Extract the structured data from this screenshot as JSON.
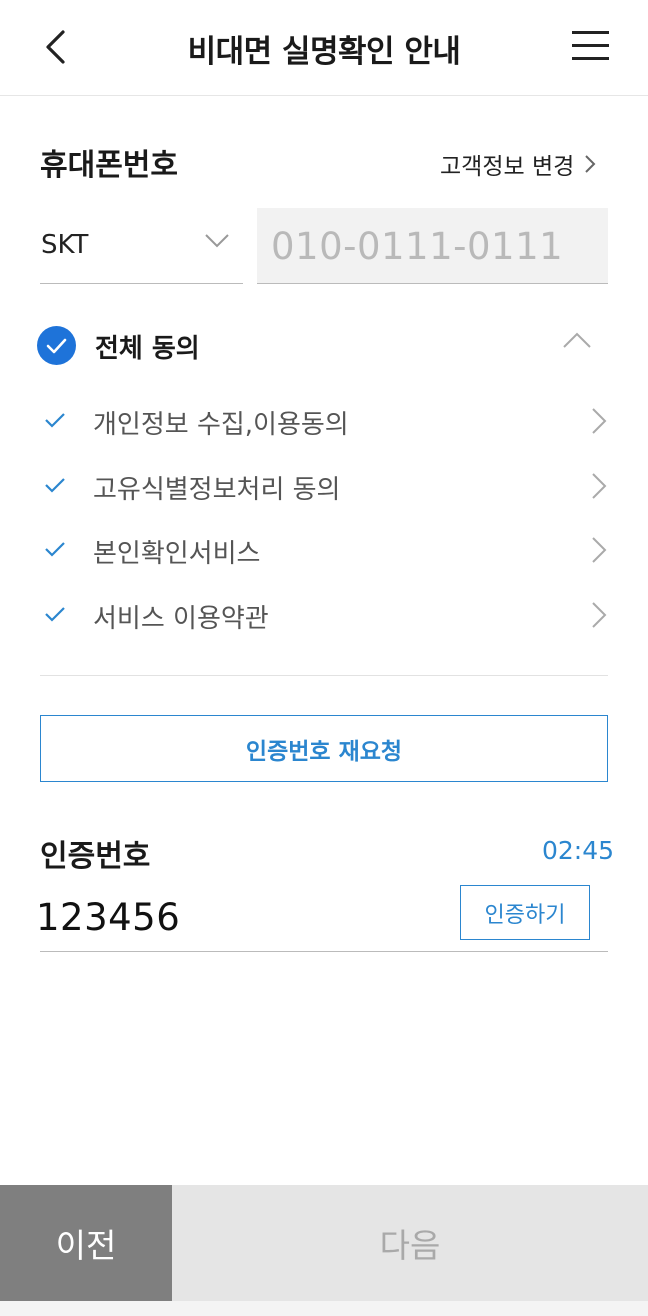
{
  "header": {
    "title": "비대면 실명확인 안내",
    "back_icon": "chevron-left-icon",
    "menu_icon": "hamburger-menu-icon"
  },
  "phone": {
    "label": "휴대폰번호",
    "change_link": "고객정보 변경",
    "carrier": "SKT",
    "number_placeholder": "010-0111-0111"
  },
  "agreements": {
    "all_label": "전체 동의",
    "all_checked": true,
    "items": [
      {
        "label": "개인정보 수집,이용동의",
        "checked": true
      },
      {
        "label": "고유식별정보처리 동의",
        "checked": true
      },
      {
        "label": "본인확인서비스",
        "checked": true
      },
      {
        "label": "서비스 이용약관",
        "checked": true
      }
    ]
  },
  "resend_button": "인증번호 재요청",
  "auth": {
    "label": "인증번호",
    "timer": "02:45",
    "code_value": "123456",
    "verify_button": "인증하기"
  },
  "footer": {
    "prev_label": "이전",
    "next_label": "다음"
  },
  "colors": {
    "accent": "#2b86cf",
    "check_fill": "#1e73d9",
    "prev_bg": "#7f7f7f",
    "next_bg": "#e5e5e5"
  }
}
